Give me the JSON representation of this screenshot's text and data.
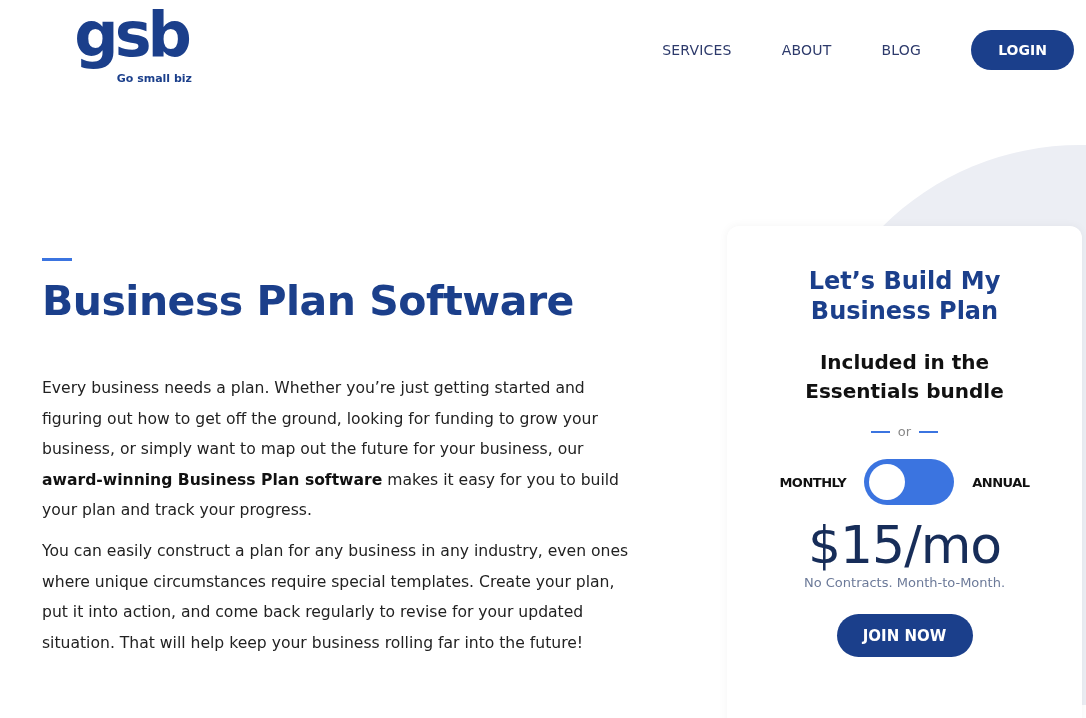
{
  "logo": {
    "mark": "gsb",
    "tagline": "Go small biz"
  },
  "nav": [
    {
      "label": "SERVICES",
      "kind": "link"
    },
    {
      "label": "ABOUT",
      "kind": "link"
    },
    {
      "label": "BLOG",
      "kind": "link"
    },
    {
      "label": "LOGIN",
      "kind": "button"
    }
  ],
  "hero": {
    "title": "Business Plan Software",
    "paragraphs": [
      "Every business needs a plan. Whether you’re just getting started and figuring out how to get off the ground, looking for funding to grow your business, or simply want to map out the future for your business, our **award-winning Business Plan software** makes it easy for you to build your plan and track your progress.",
      "You can easily construct a plan for any business in any industry, even ones where unique circumstances require special templates. Create your plan, put it into action, and come back regularly to revise for your updated situation. That will help keep your business rolling far into the future!"
    ]
  },
  "card": {
    "title": "Let’s Build My Business Plan",
    "subtitle": "Included in the Essentials bundle",
    "divider": "or",
    "toggle": {
      "left_label": "MONTHLY",
      "right_label": "ANNUAL",
      "on": false
    },
    "price": "$15/mo",
    "note": "No Contracts. Month-to-Month.",
    "button": "JOIN NOW"
  }
}
